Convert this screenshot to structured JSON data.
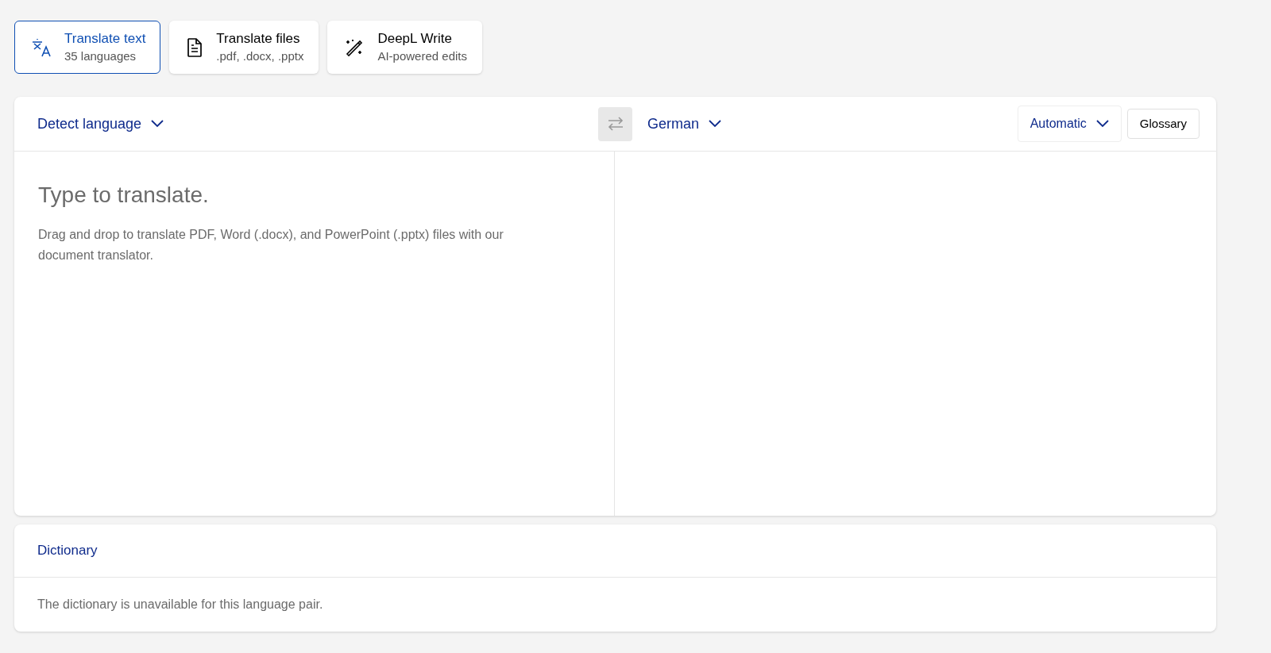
{
  "tabs": [
    {
      "label": "Translate text",
      "sublabel": "35 languages",
      "selected": true
    },
    {
      "label": "Translate files",
      "sublabel": ".pdf, .docx, .pptx",
      "selected": false
    },
    {
      "label": "DeepL Write",
      "sublabel": "AI-powered edits",
      "selected": false
    }
  ],
  "translator": {
    "source_language": "Detect language",
    "target_language": "German",
    "formality": "Automatic",
    "glossary_button": "Glossary",
    "source": {
      "placeholder": "Type to translate.",
      "hint": "Drag and drop to translate PDF, Word (.docx), and PowerPoint (.pptx) files with our document translator."
    }
  },
  "dictionary": {
    "title": "Dictionary",
    "message": "The dictionary is unavailable for this language pair."
  }
}
